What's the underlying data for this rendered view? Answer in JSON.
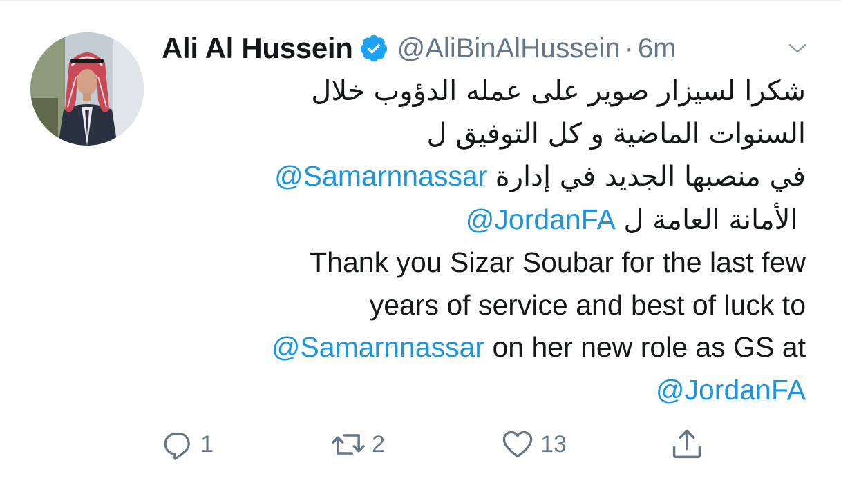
{
  "tweet": {
    "author": {
      "display_name": "Ali Al Hussein",
      "handle": "@AliBinAlHussein",
      "verified": true,
      "avatar_icon": "profile-photo"
    },
    "separator": "·",
    "timestamp": "6m",
    "more_icon": "chevron-down-icon",
    "text": {
      "ar_line_1": "شكرا لسيزار صوير على عمله الدؤوب خلال",
      "ar_line_2": "السنوات الماضية و كل التوفيق ل",
      "ar_line_3_mention": "@Samarnnassar",
      "ar_line_3_text": "في منصبها الجديد في إدارة",
      "ar_line_4_text": "الأمانة العامة ل",
      "ar_line_4_mention": "@JordanFA",
      "en_line_1": "Thank you Sizar Soubar for the last few",
      "en_line_2": "years of service and best of luck to",
      "en_line_3_mention": "@Samarnnassar",
      "en_line_3_text": "on her new role as GS at",
      "en_line_4_mention": "@JordanFA"
    },
    "actions": {
      "reply": {
        "icon": "reply-icon",
        "count": "1"
      },
      "retweet": {
        "icon": "retweet-icon",
        "count": "2"
      },
      "like": {
        "icon": "heart-icon",
        "count": "13"
      },
      "share": {
        "icon": "share-icon"
      }
    }
  },
  "colors": {
    "text": "#14171a",
    "muted": "#657786",
    "link": "#1b95e0",
    "verified": "#1da1f2",
    "divider": "#e6ecf0"
  }
}
